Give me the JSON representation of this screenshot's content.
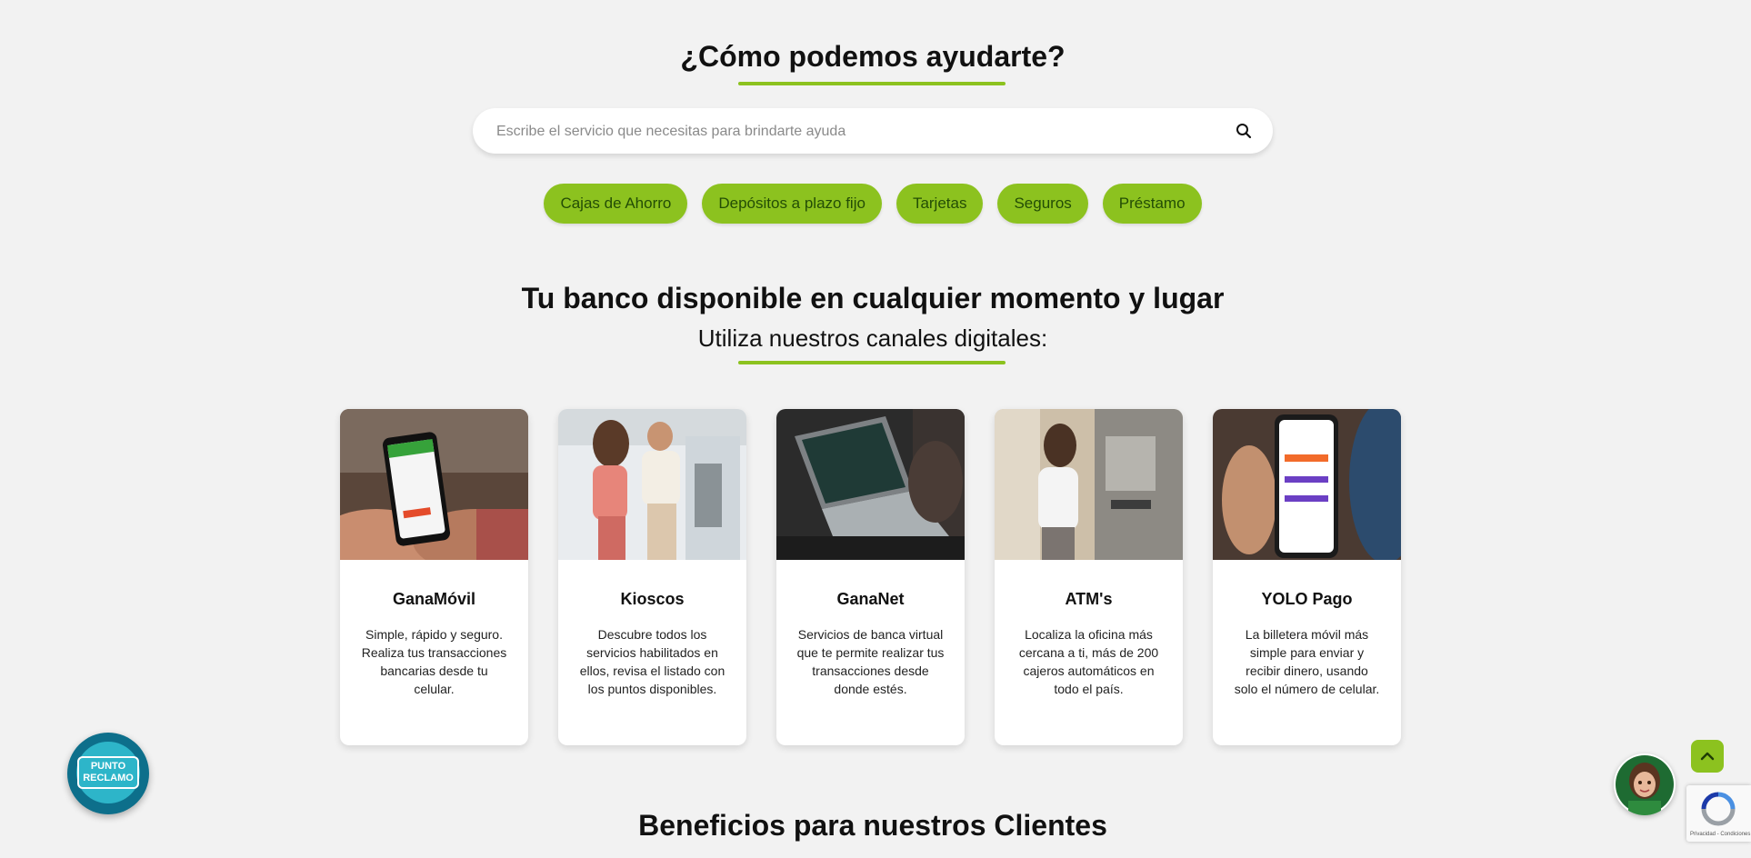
{
  "help": {
    "title": "¿Cómo podemos ayudarte?",
    "search_placeholder": "Escribe el servicio que necesitas para brindarte ayuda",
    "search_icon": "search-icon",
    "chips": [
      "Cajas de Ahorro",
      "Depósitos a plazo fijo",
      "Tarjetas",
      "Seguros",
      "Préstamo"
    ]
  },
  "channels": {
    "title": "Tu banco disponible en cualquier momento y lugar",
    "subtitle": "Utiliza nuestros canales digitales:",
    "cards": [
      {
        "title": "GanaMóvil",
        "desc": "Simple, rápido y seguro. Realiza tus transacciones bancarias desde tu celular."
      },
      {
        "title": "Kioscos",
        "desc": "Descubre todos los servicios habilitados en ellos, revisa el listado con los puntos disponibles."
      },
      {
        "title": "GanaNet",
        "desc": "Servicios de banca virtual que te permite realizar tus transacciones desde donde estés."
      },
      {
        "title": "ATM's",
        "desc": "Localiza la oficina más cercana a ti, más de 200 cajeros automáticos en todo el país."
      },
      {
        "title": "YOLO Pago",
        "desc": "La billetera móvil más simple para enviar y recibir dinero, usando solo el número de celular."
      }
    ]
  },
  "benefits": {
    "title": "Beneficios para nuestros Clientes"
  },
  "widgets": {
    "punto_reclamo": {
      "line1": "PUNTO",
      "line2": "RECLAMO"
    },
    "recaptcha_footer": "Privacidad - Condiciones"
  },
  "colors": {
    "accent": "#8cc21f",
    "background": "#f2f2f2",
    "punto": "#0d6f8b"
  }
}
